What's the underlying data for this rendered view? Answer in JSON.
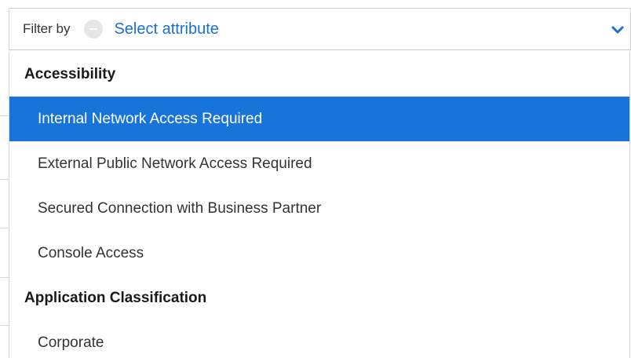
{
  "filter": {
    "label": "Filter by",
    "placeholder": "Select attribute",
    "clear_icon": "minus-circle-icon",
    "toggle_icon": "chevron-down-icon",
    "accent_color": "#1874d8"
  },
  "groups": [
    {
      "title": "Accessibility",
      "options": [
        {
          "label": "Internal Network Access Required",
          "selected": true
        },
        {
          "label": "External Public Network Access Required",
          "selected": false
        },
        {
          "label": "Secured Connection with Business Partner",
          "selected": false
        },
        {
          "label": "Console Access",
          "selected": false
        }
      ]
    },
    {
      "title": "Application Classification",
      "options": [
        {
          "label": "Corporate",
          "selected": false
        }
      ]
    }
  ]
}
